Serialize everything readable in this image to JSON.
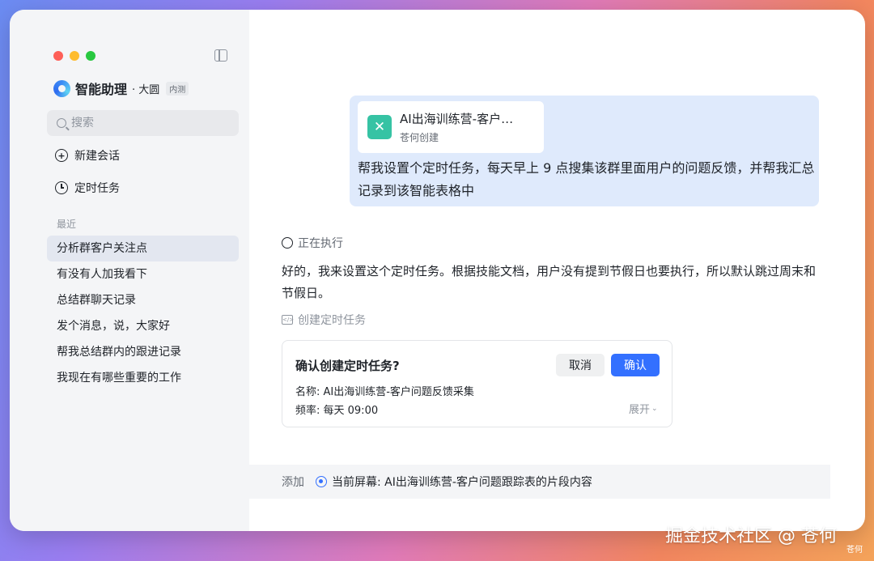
{
  "sidebar": {
    "brand_name": "智能助理",
    "brand_sub": "· 大圆",
    "brand_badge": "内测",
    "search_placeholder": "搜索",
    "new_chat": "新建会话",
    "scheduled_tasks": "定时任务",
    "recent_label": "最近",
    "history": [
      "分析群客户关注点",
      "有没有人加我看下",
      "总结群聊天记录",
      "发个消息，说，大家好",
      "帮我总结群内的跟进记录",
      "我现在有哪些重要的工作"
    ]
  },
  "chat": {
    "file_card": {
      "title": "AI出海训练营-客户…",
      "sub": "苍何创建",
      "icon": "spreadsheet-icon"
    },
    "user_message": "帮我设置个定时任务，每天早上 9 点搜集该群里面用户的问题反馈，并帮我汇总记录到该智能表格中",
    "status": "正在执行",
    "reply": "好的，我来设置这个定时任务。根据技能文档，用户没有提到节假日也要执行，所以默认跳过周末和节假日。",
    "tool_call": "创建定时任务",
    "confirm": {
      "title": "确认创建定时任务?",
      "cancel": "取消",
      "ok": "确认",
      "name_line": "名称:  AI出海训练营-客户问题反馈采集",
      "freq_line": "频率:  每天 09:00",
      "expand": "展开"
    }
  },
  "bottom_bar": {
    "add": "添加",
    "context": "当前屏幕: AI出海训练营-客户问题跟踪表的片段内容"
  },
  "watermark": {
    "text": "掘金技术社区 @ 苍何",
    "small": "苍何"
  },
  "colors": {
    "accent": "#3370ff",
    "user_bubble": "#dfeafc",
    "sidebar_bg": "#f4f5f7"
  }
}
